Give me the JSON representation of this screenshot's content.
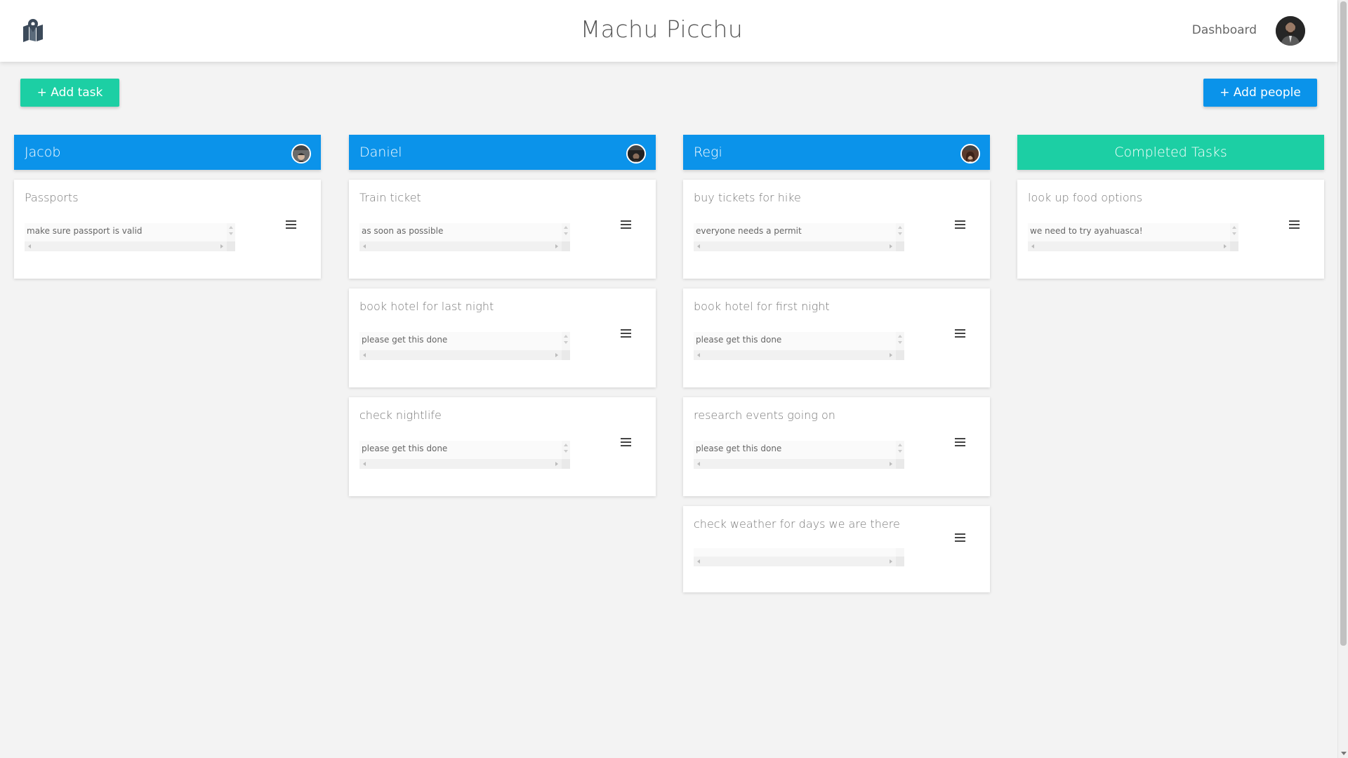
{
  "app": {
    "title": "Machu Picchu",
    "nav_link": "Dashboard"
  },
  "buttons": {
    "add_task": "+ Add task",
    "add_people": "+ Add people"
  },
  "colors": {
    "blue": "#0b93ea",
    "green": "#1ccfa4",
    "background": "#f3f3f3"
  },
  "columns": [
    {
      "name": "Jacob",
      "cards": [
        {
          "title": "Passports",
          "note": "make sure passport is valid"
        }
      ]
    },
    {
      "name": "Daniel",
      "cards": [
        {
          "title": "Train ticket",
          "note": "as soon as possible"
        },
        {
          "title": "book hotel for last night",
          "note": "please get this done"
        },
        {
          "title": "check nightlife",
          "note": "please get this done"
        }
      ]
    },
    {
      "name": "Regi",
      "cards": [
        {
          "title": "buy tickets for hike",
          "note": "everyone needs a permit"
        },
        {
          "title": "book hotel for first night",
          "note": "please get this done"
        },
        {
          "title": "research events going on",
          "note": "please get this done"
        },
        {
          "title": "check weather for days we are there",
          "note": ""
        }
      ]
    },
    {
      "name": "Completed Tasks",
      "cards": [
        {
          "title": "look up food options",
          "note": "we need to try ayahuasca!"
        }
      ]
    }
  ]
}
